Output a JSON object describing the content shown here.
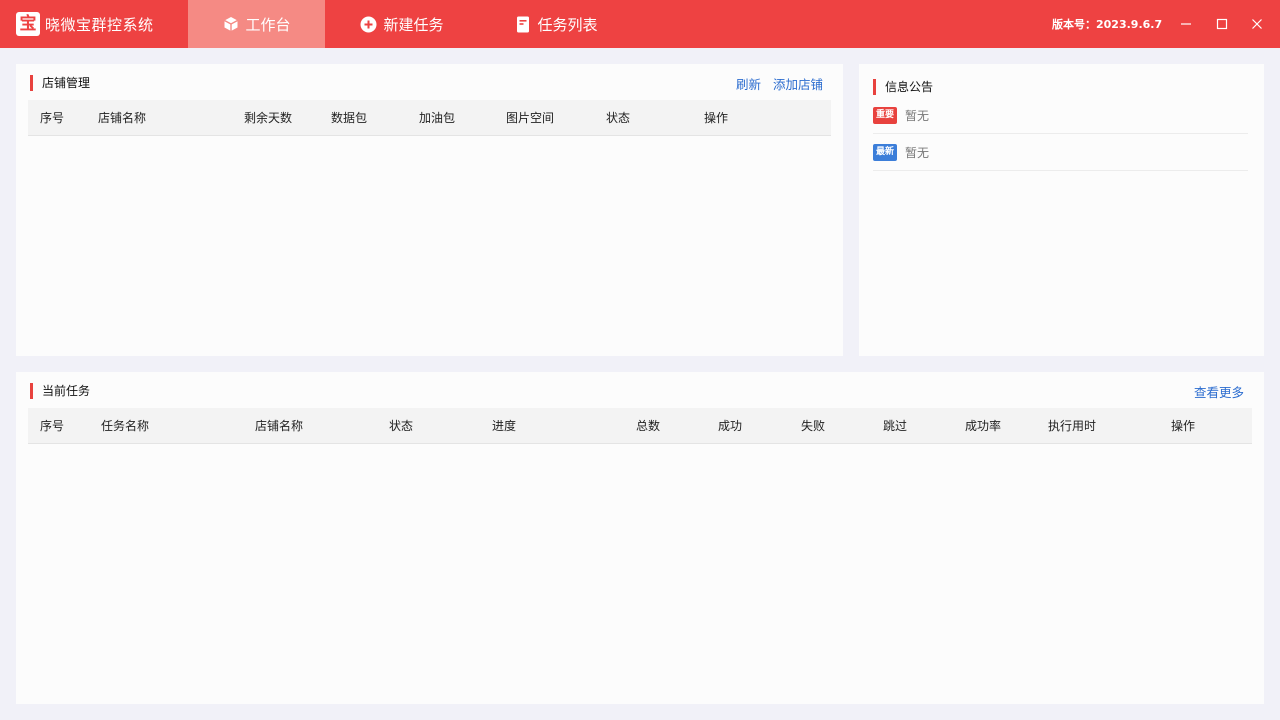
{
  "app": {
    "logo_char": "宝",
    "title": "晓微宝群控系统",
    "version": "版本号：2023.9.6.7"
  },
  "nav": [
    {
      "label": "工作台",
      "icon": "cube-icon",
      "active": true
    },
    {
      "label": "新建任务",
      "icon": "plus-circle-icon",
      "active": false
    },
    {
      "label": "任务列表",
      "icon": "document-icon",
      "active": false
    }
  ],
  "window_controls": [
    "minimize-icon",
    "maximize-icon",
    "close-icon"
  ],
  "store_panel": {
    "title": "店铺管理",
    "actions": [
      "刷新",
      "添加店铺"
    ],
    "columns": [
      "序号",
      "店铺名称",
      "剩余天数",
      "数据包",
      "加油包",
      "图片空间",
      "状态",
      "操作"
    ],
    "rows": []
  },
  "notice_panel": {
    "title": "信息公告",
    "items": [
      {
        "tag": "重要",
        "tag_color": "#e8423e",
        "text": "暂无"
      },
      {
        "tag": "最新",
        "tag_color": "#3c7ed9",
        "text": "暂无"
      }
    ]
  },
  "task_panel": {
    "title": "当前任务",
    "action": "查看更多",
    "columns": [
      "序号",
      "任务名称",
      "店铺名称",
      "状态",
      "进度",
      "总数",
      "成功",
      "失败",
      "跳过",
      "成功率",
      "执行用时",
      "操作"
    ],
    "rows": []
  },
  "colors": {
    "brand": "#ee4242",
    "nav_active": "#f58a84",
    "link": "#2b6ccf",
    "accent_bar": "#e8423e"
  }
}
